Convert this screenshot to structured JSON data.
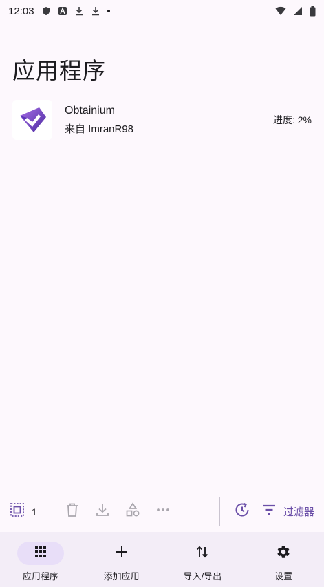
{
  "status_bar": {
    "time": "12:03",
    "icons": [
      "shield-icon",
      "a-badge-icon",
      "download-icon",
      "download-icon",
      "dot-icon"
    ],
    "right_icons": [
      "wifi-icon",
      "signal-icon",
      "battery-icon"
    ]
  },
  "page": {
    "title": "应用程序"
  },
  "apps": [
    {
      "name": "Obtainium",
      "source": "来自 ImranR98",
      "progress": "进度: 2%",
      "icon": "obtainium-logo"
    }
  ],
  "action_bar": {
    "selected_count": "1",
    "filter_label": "过滤器"
  },
  "bottom_nav": {
    "items": [
      {
        "label": "应用程序",
        "icon": "grid-icon",
        "active": true
      },
      {
        "label": "添加应用",
        "icon": "plus-icon",
        "active": false
      },
      {
        "label": "导入/导出",
        "icon": "import-export-icon",
        "active": false
      },
      {
        "label": "设置",
        "icon": "gear-icon",
        "active": false
      }
    ]
  },
  "colors": {
    "accent": "#6b4fa8",
    "background": "#fdf8fd",
    "nav_background": "#f3edf7",
    "nav_active_pill": "#e8def8",
    "disabled_icon": "#a9a6ad"
  }
}
